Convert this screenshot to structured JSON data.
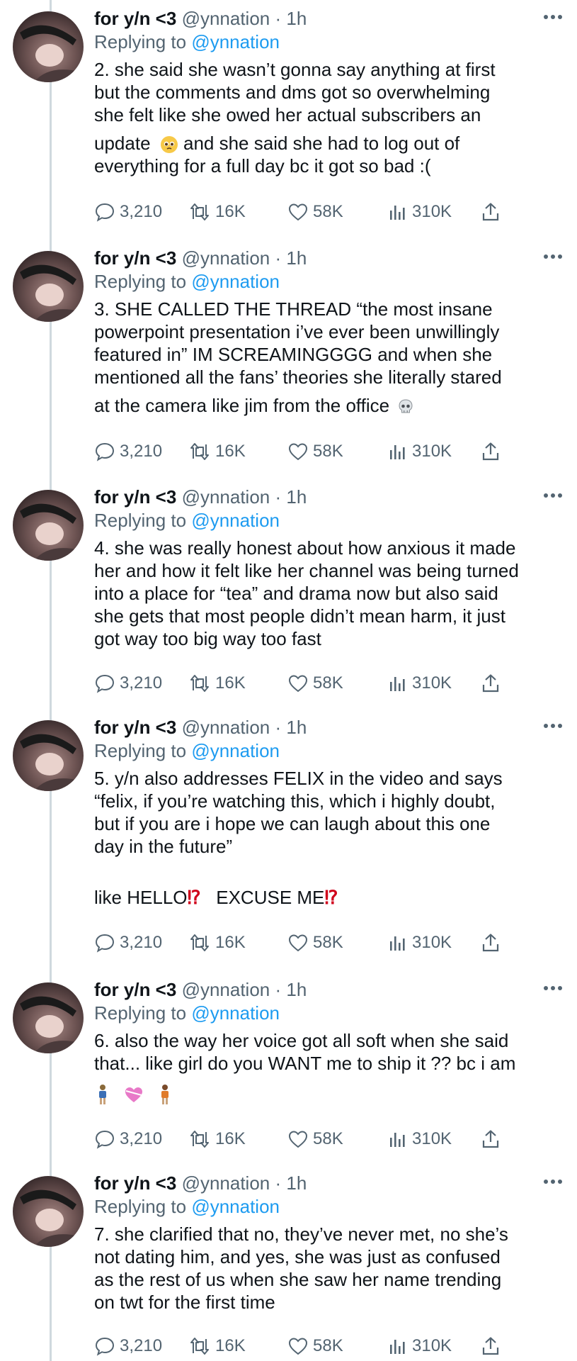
{
  "tweets": [
    {
      "name": "for y/n <3",
      "handle": "@ynnation",
      "sep": "·",
      "time": "1h",
      "reply_prefix": "Replying to ",
      "reply_to": "@ynnation",
      "lines": [
        "2. she said she wasn’t gonna say anything at first",
        "but the comments and dms got so overwhelming",
        "she felt like she owed her actual subscribers an",
        "update",
        " and she said she had to log out of",
        "everything for a full day bc it got so bad :("
      ],
      "emoji": "pleading-face",
      "stats": {
        "replies": "3,210",
        "retweets": "16K",
        "likes": "58K",
        "views": "310K"
      }
    },
    {
      "name": "for y/n <3",
      "handle": "@ynnation",
      "sep": "·",
      "time": "1h",
      "reply_prefix": "Replying to ",
      "reply_to": "@ynnation",
      "lines": [
        "3. SHE CALLED THE THREAD “the most insane",
        "powerpoint presentation i’ve ever been unwillingly",
        "featured in” IM SCREAMINGGGG and when she",
        "mentioned all the fans’ theories she literally stared",
        "at the camera like jim from the office"
      ],
      "emoji": "skull",
      "stats": {
        "replies": "3,210",
        "retweets": "16K",
        "likes": "58K",
        "views": "310K"
      }
    },
    {
      "name": "for y/n <3",
      "handle": "@ynnation",
      "sep": "·",
      "time": "1h",
      "reply_prefix": "Replying to ",
      "reply_to": "@ynnation",
      "lines": [
        "4. she was really honest about how anxious it made",
        "her and how it felt like her channel was being turned",
        "into a place for “tea” and drama now but also said",
        "she gets that most people didn’t mean harm, it just",
        "got way too big way too fast"
      ],
      "stats": {
        "replies": "3,210",
        "retweets": "16K",
        "likes": "58K",
        "views": "310K"
      }
    },
    {
      "name": "for y/n <3",
      "handle": "@ynnation",
      "sep": "·",
      "time": "1h",
      "reply_prefix": "Replying to ",
      "reply_to": "@ynnation",
      "lines": [
        "5. y/n also addresses FELIX in the video and says",
        "“felix, if you’re watching this, which i highly doubt,",
        "but if you are i hope we can laugh about this one",
        "day in the future”"
      ],
      "extra_a": "like HELLO",
      "extra_b": "EXCUSE ME",
      "interrobang": "⁉",
      "stats": {
        "replies": "3,210",
        "retweets": "16K",
        "likes": "58K",
        "views": "310K"
      }
    },
    {
      "name": "for y/n <3",
      "handle": "@ynnation",
      "sep": "·",
      "time": "1h",
      "reply_prefix": "Replying to ",
      "reply_to": "@ynnation",
      "lines": [
        "6. also the way her voice got all soft when she said",
        "that... like girl do you WANT me to ship it ?? bc i am"
      ],
      "emoji": "person-heart-person",
      "stats": {
        "replies": "3,210",
        "retweets": "16K",
        "likes": "58K",
        "views": "310K"
      }
    },
    {
      "name": "for y/n <3",
      "handle": "@ynnation",
      "sep": "·",
      "time": "1h",
      "reply_prefix": "Replying to ",
      "reply_to": "@ynnation",
      "lines": [
        "7. she clarified that no, they’ve never met, no she’s",
        "not dating him, and yes, she was just as confused",
        "as the rest of us when she saw her name trending",
        "on twt for the first time"
      ],
      "stats": {
        "replies": "3,210",
        "retweets": "16K",
        "likes": "58K",
        "views": "310K"
      }
    }
  ],
  "icons": {
    "reply": "reply-icon",
    "retweet": "retweet-icon",
    "like": "heart-icon",
    "views": "views-icon",
    "share": "share-icon",
    "more": "more-icon"
  },
  "colors": {
    "link": "#1d9bf0",
    "secondary": "#536471",
    "text": "#0f1419",
    "thread_line": "#cfd9de",
    "interrobang": "#d0021b"
  }
}
